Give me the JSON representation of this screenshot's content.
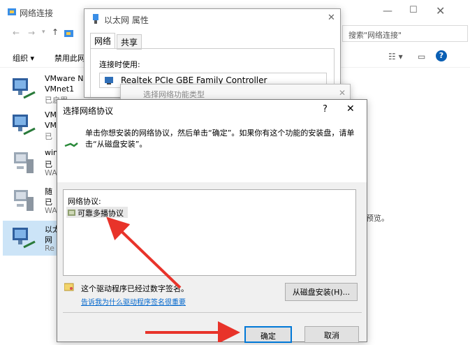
{
  "explorer": {
    "title": "网络连接",
    "search_placeholder": "搜索\"网络连接\"",
    "toolbar": {
      "organize": "组织 ▾",
      "disable": "禁用此网"
    },
    "items": [
      {
        "name": "VMware Ne",
        "sub": "VMnet1",
        "status": "已启用"
      },
      {
        "name": "VM",
        "sub": "VM",
        "status": "已"
      },
      {
        "name": "win",
        "sub": "已",
        "status": "WA"
      },
      {
        "name": "随",
        "sub": "已",
        "status": "WA"
      },
      {
        "name": "以太",
        "sub": "网",
        "status": "Re"
      }
    ],
    "right_hint": "预览。"
  },
  "ethernet_props": {
    "title": "以太网 属性",
    "tabs": [
      "网络",
      "共享"
    ],
    "connect_using_label": "连接时使用:",
    "adapter": "Realtek PCIe GBE Family Controller"
  },
  "feature_type_dialog": {
    "title": "选择网络功能类型"
  },
  "protocol_dialog": {
    "title": "选择网络协议",
    "help": "?",
    "instruction": "单击你想安装的网络协议，然后单击“确定”。如果你有这个功能的安装盘，请单击“从磁盘安装”。",
    "list_label": "网络协议:",
    "list_items": [
      "可靠多播协议"
    ],
    "signed_text": "这个驱动程序已经过数字签名。",
    "signing_link": "告诉我为什么驱动程序签名很重要",
    "have_disk": "从磁盘安装(H)...",
    "ok": "确定",
    "cancel": "取消"
  },
  "colors": {
    "accent": "#0078d7",
    "arrow": "#e8332a",
    "link": "#0066cc"
  }
}
